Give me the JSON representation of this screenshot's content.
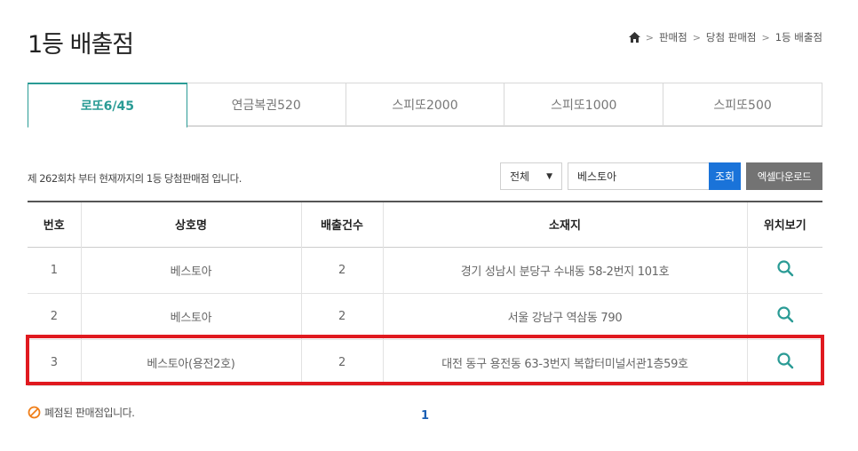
{
  "page": {
    "title": "1등 배출점"
  },
  "breadcrumb": {
    "items": [
      "판매점",
      "당첨 판매점",
      "1등 배출점"
    ],
    "separator": ">"
  },
  "tabs": [
    {
      "label": "로또6/45",
      "active": true
    },
    {
      "label": "연금복권520",
      "active": false
    },
    {
      "label": "스피또2000",
      "active": false
    },
    {
      "label": "스피또1000",
      "active": false
    },
    {
      "label": "스피또500",
      "active": false
    }
  ],
  "info": {
    "text": "제 262회차 부터 현재까지의 1등 당첨판매점 입니다."
  },
  "search": {
    "select_value": "전체",
    "input_value": "베스토아",
    "search_label": "조회",
    "excel_label": "엑셀다운로드"
  },
  "table": {
    "headers": [
      "번호",
      "상호명",
      "배출건수",
      "소재지",
      "위치보기"
    ],
    "rows": [
      {
        "no": "1",
        "name": "베스토아",
        "count": "2",
        "address": "경기 성남시 분당구 수내동 58-2번지 101호"
      },
      {
        "no": "2",
        "name": "베스토아",
        "count": "2",
        "address": "서울 강남구 역삼동 790"
      },
      {
        "no": "3",
        "name": "베스토아(용전2호)",
        "count": "2",
        "address": "대전 동구 용전동 63-3번지 복합터미널서관1층59호"
      }
    ]
  },
  "footer": {
    "closed_note": "폐점된 판매점입니다.",
    "current_page": "1"
  },
  "colors": {
    "accent": "#2a9b95",
    "search_button": "#1a73d9",
    "highlight": "#e0191f",
    "excel_button": "#737373",
    "closed_icon": "#f07f1a"
  }
}
